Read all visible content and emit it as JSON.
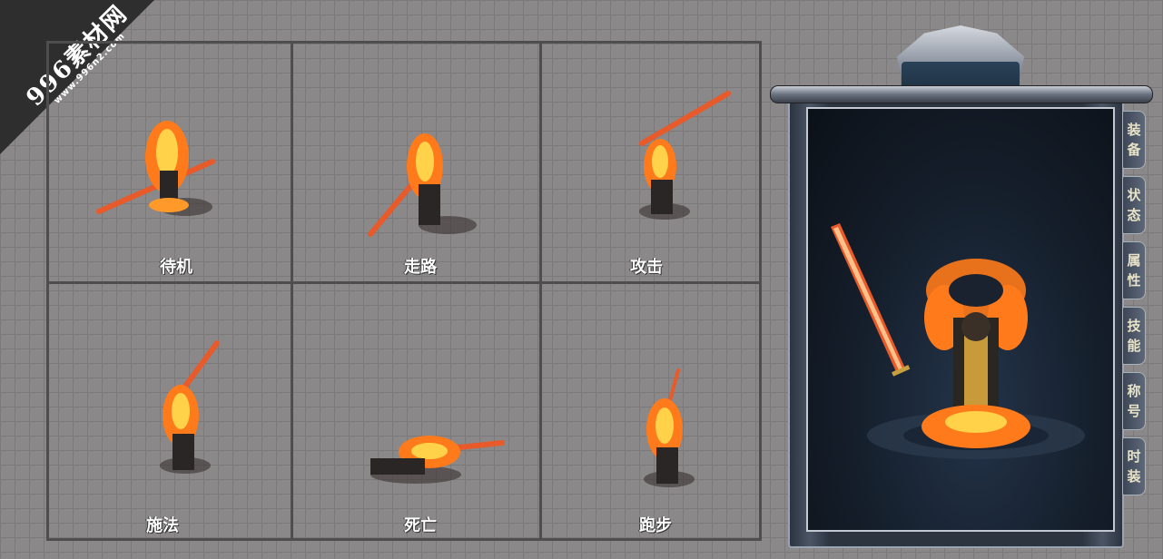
{
  "watermark": {
    "main": "996素材网",
    "sub": "www.996n2.com"
  },
  "cells": [
    {
      "label": "待机"
    },
    {
      "label": "走路"
    },
    {
      "label": "攻击"
    },
    {
      "label": "施法"
    },
    {
      "label": "死亡"
    },
    {
      "label": "跑步"
    }
  ],
  "panel": {
    "tabs": [
      {
        "c1": "装",
        "c2": "备"
      },
      {
        "c1": "状",
        "c2": "态"
      },
      {
        "c1": "属",
        "c2": "性"
      },
      {
        "c1": "技",
        "c2": "能"
      },
      {
        "c1": "称",
        "c2": "号"
      },
      {
        "c1": "时",
        "c2": "装"
      }
    ]
  },
  "colors": {
    "fire": "#ff7a1a",
    "fire_core": "#ffd24a",
    "blade": "#e85a2a",
    "grid_line": "#4e4e4e"
  }
}
